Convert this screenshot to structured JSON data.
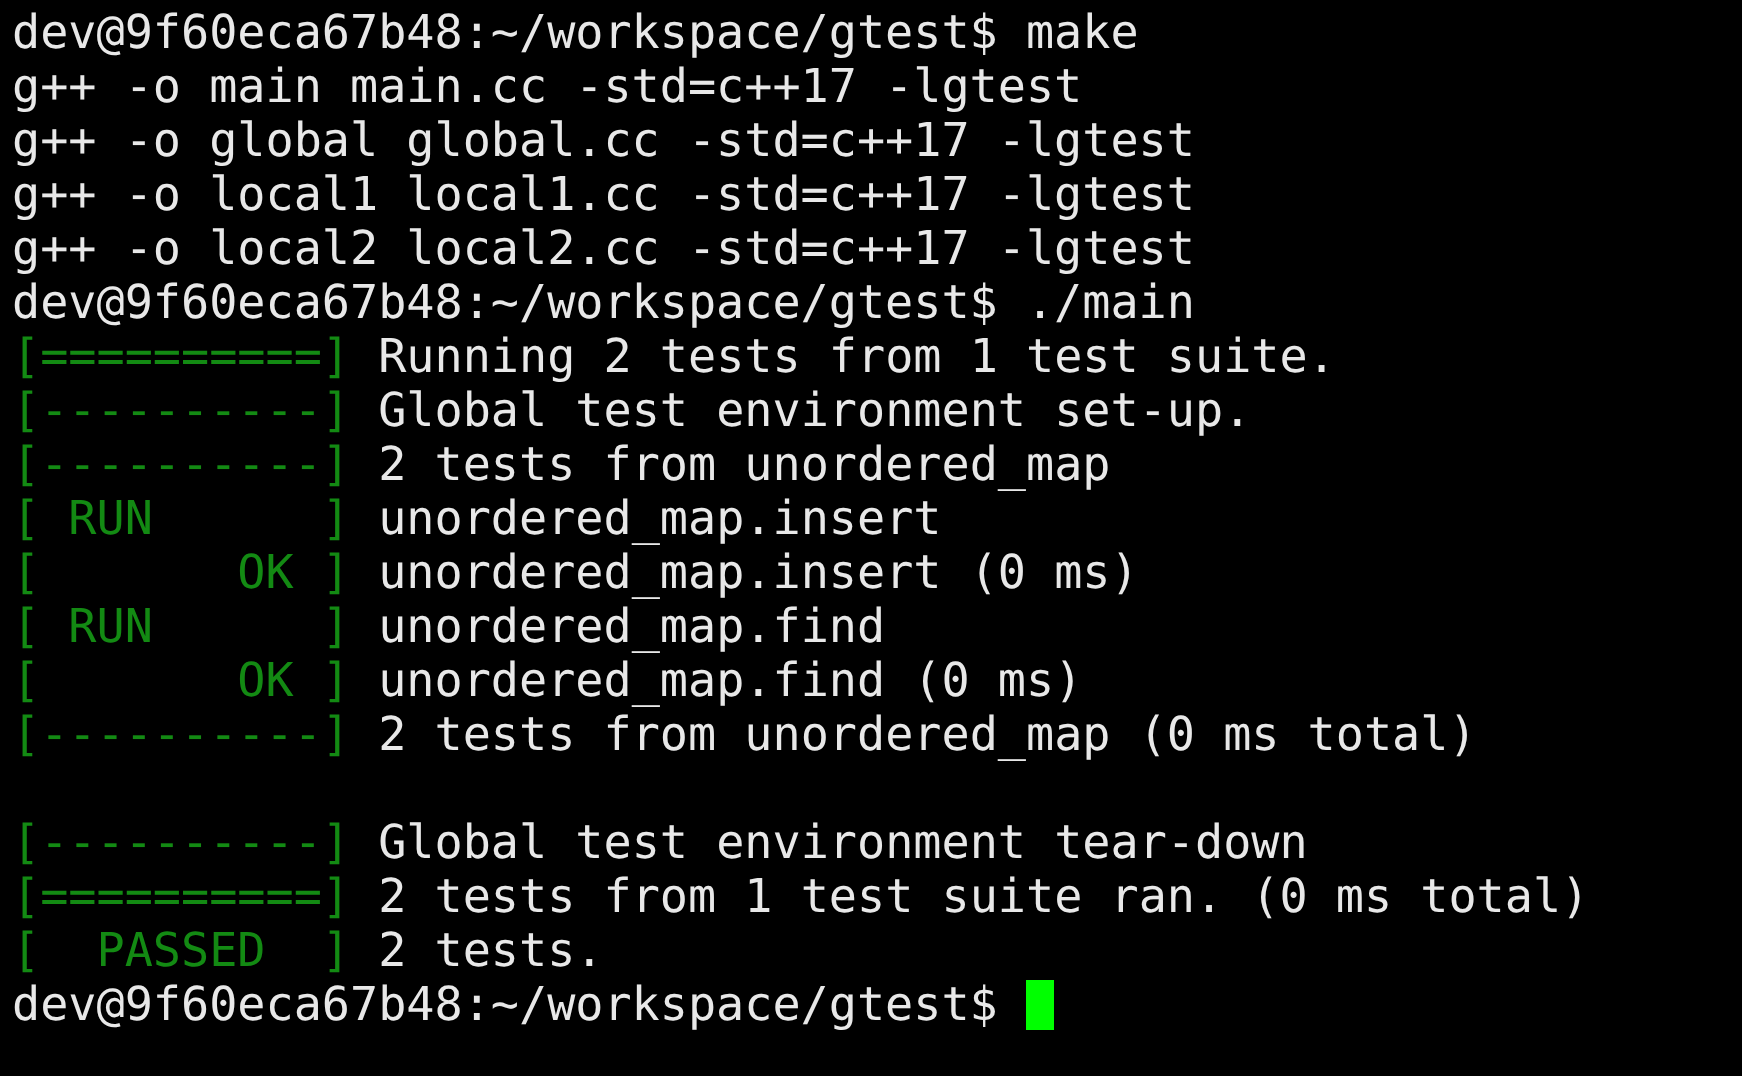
{
  "lines": [
    {
      "kind": "plain",
      "text": "dev@9f60eca67b48:~/workspace/gtest$ make"
    },
    {
      "kind": "plain",
      "text": "g++ -o main main.cc -std=c++17 -lgtest"
    },
    {
      "kind": "plain",
      "text": "g++ -o global global.cc -std=c++17 -lgtest"
    },
    {
      "kind": "plain",
      "text": "g++ -o local1 local1.cc -std=c++17 -lgtest"
    },
    {
      "kind": "plain",
      "text": "g++ -o local2 local2.cc -std=c++17 -lgtest"
    },
    {
      "kind": "plain",
      "text": "dev@9f60eca67b48:~/workspace/gtest$ ./main"
    },
    {
      "kind": "test",
      "tag": "[==========]",
      "text": "Running 2 tests from 1 test suite."
    },
    {
      "kind": "test",
      "tag": "[----------]",
      "text": "Global test environment set-up."
    },
    {
      "kind": "test",
      "tag": "[----------]",
      "text": "2 tests from unordered_map"
    },
    {
      "kind": "test",
      "tag": "[ RUN      ]",
      "text": "unordered_map.insert"
    },
    {
      "kind": "test",
      "tag": "[       OK ]",
      "text": "unordered_map.insert (0 ms)"
    },
    {
      "kind": "test",
      "tag": "[ RUN      ]",
      "text": "unordered_map.find"
    },
    {
      "kind": "test",
      "tag": "[       OK ]",
      "text": "unordered_map.find (0 ms)"
    },
    {
      "kind": "test",
      "tag": "[----------]",
      "text": "2 tests from unordered_map (0 ms total)"
    },
    {
      "kind": "blank"
    },
    {
      "kind": "test",
      "tag": "[----------]",
      "text": "Global test environment tear-down"
    },
    {
      "kind": "test",
      "tag": "[==========]",
      "text": "2 tests from 1 test suite ran. (0 ms total)"
    },
    {
      "kind": "test",
      "tag": "[  PASSED  ]",
      "text": "2 tests."
    },
    {
      "kind": "plain",
      "text": "dev@9f60eca67b48:~/workspace/gtest$ ",
      "cursor": true
    }
  ]
}
